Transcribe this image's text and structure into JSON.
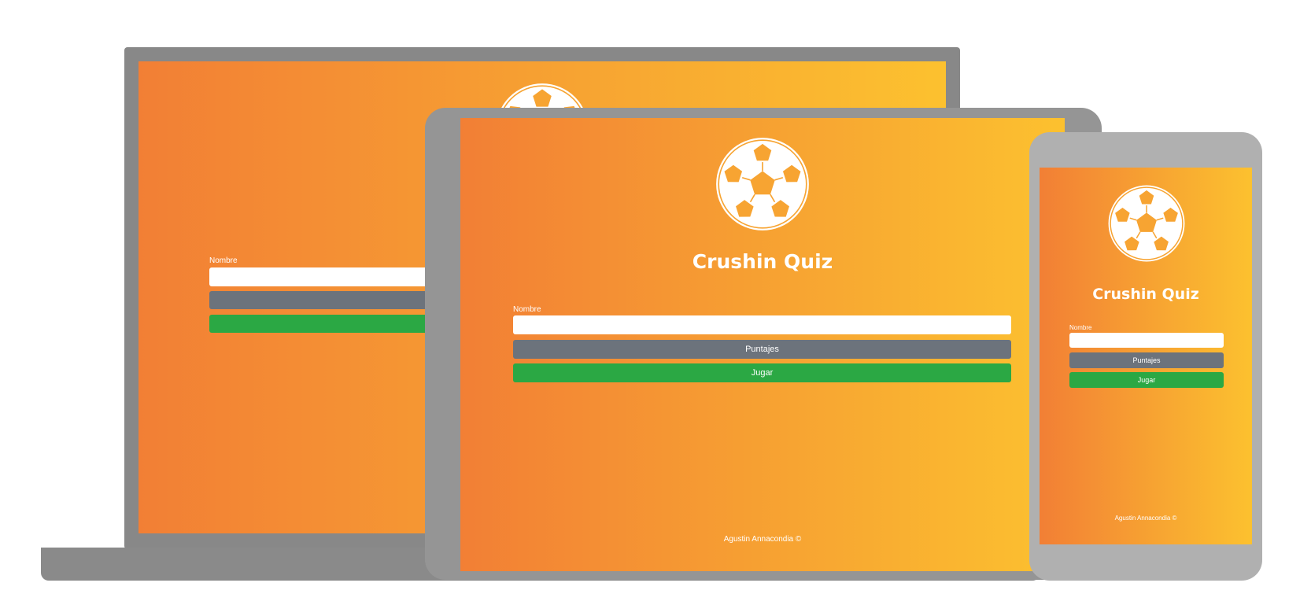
{
  "app": {
    "title": "Crushin Quiz",
    "name_label": "Nombre",
    "name_value": "",
    "scores_button": "Puntajes",
    "play_button": "Jugar",
    "footer": "Agustin Annacondia ©",
    "logo_icon": "soccer-ball-icon"
  },
  "colors": {
    "gradient_start": "#f27f35",
    "gradient_end": "#fcc12f",
    "scores_button": "#6c737c",
    "play_button": "#2ba844"
  }
}
